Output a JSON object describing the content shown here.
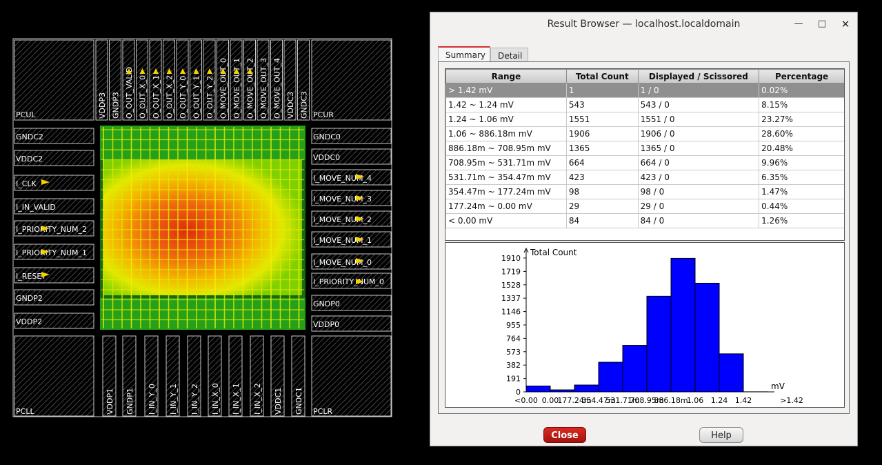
{
  "layout_view": {
    "corner_labels": [
      "PCUL",
      "PCUR",
      "PCLL",
      "PCLR"
    ],
    "left_pads": [
      "GNDC2",
      "VDDC2",
      "I_CLK",
      "I_IN_VALID",
      "I_PRIORITY_NUM_2",
      "I_PRIORITY_NUM_1",
      "I_RESET",
      "GNDP2",
      "VDDP2"
    ],
    "right_pads": [
      "GNDC0",
      "VDDC0",
      "I_MOVE_NUM_4",
      "I_MOVE_NUM_3",
      "I_MOVE_NUM_2",
      "I_MOVE_NUM_1",
      "I_MOVE_NUM_0",
      "I_PRIORITY_NUM_0",
      "GNDP0",
      "VDDP0"
    ],
    "top_pads": [
      "VDDP3",
      "GNDP3",
      "O_OUT_VALID",
      "O_OUT_X_0",
      "O_OUT_X_1",
      "O_OUT_X_2",
      "O_OUT_Y_0",
      "O_OUT_Y_1",
      "O_OUT_Y_2",
      "O_MOVE_OUT_0",
      "O_MOVE_OUT_1",
      "O_MOVE_OUT_2",
      "O_MOVE_OUT_3",
      "O_MOVE_OUT_4",
      "VDDC3",
      "GNDC3"
    ],
    "bottom_pads": [
      "VDDP1",
      "GNDP1",
      "I_IN_Y_0",
      "I_IN_Y_1",
      "I_IN_Y_2",
      "I_IN_X_0",
      "I_IN_X_1",
      "I_IN_X_2",
      "VDDC1",
      "GNDC1"
    ]
  },
  "dialog": {
    "title": "Result Browser — localhost.localdomain",
    "minimize_icon": "minimize-icon",
    "maximize_icon": "maximize-icon",
    "close_icon": "close-icon",
    "tabs": [
      {
        "label": "Summary",
        "active": true
      },
      {
        "label": "Detail",
        "active": false
      }
    ],
    "table": {
      "headers": [
        "Range",
        "Total Count",
        "Displayed / Scissored",
        "Percentage"
      ],
      "rows": [
        [
          "> 1.42 mV",
          "1",
          "1 / 0",
          "0.02%"
        ],
        [
          "1.42 ~ 1.24 mV",
          "543",
          "543 / 0",
          "8.15%"
        ],
        [
          "1.24 ~ 1.06 mV",
          "1551",
          "1551 / 0",
          "23.27%"
        ],
        [
          "1.06 ~ 886.18m mV",
          "1906",
          "1906 / 0",
          "28.60%"
        ],
        [
          "886.18m ~ 708.95m mV",
          "1365",
          "1365 / 0",
          "20.48%"
        ],
        [
          "708.95m ~ 531.71m mV",
          "664",
          "664 / 0",
          "9.96%"
        ],
        [
          "531.71m ~ 354.47m mV",
          "423",
          "423 / 0",
          "6.35%"
        ],
        [
          "354.47m ~ 177.24m mV",
          "98",
          "98 / 0",
          "1.47%"
        ],
        [
          "177.24m ~ 0.00 mV",
          "29",
          "29 / 0",
          "0.44%"
        ],
        [
          "< 0.00 mV",
          "84",
          "84 / 0",
          "1.26%"
        ]
      ],
      "selected_row": 0
    },
    "close_button": "Close",
    "help_button": "Help"
  },
  "chart_data": {
    "type": "bar",
    "ylabel": "Total Count",
    "xlabel": "mV",
    "y_ticks": [
      "0",
      "191",
      "382",
      "573",
      "764",
      "955",
      "1146",
      "1337",
      "1528",
      "1719",
      "1910"
    ],
    "x_tick_labels": [
      "<0.00",
      "0.00",
      "177.24m",
      "354.47m",
      "531.71m",
      "708.95m",
      "886.18m",
      "1.06",
      "1.24",
      "1.42",
      ">1.42"
    ],
    "categories": [
      "<0.00",
      "0.00~177.24m",
      "177.24m~354.47m",
      "354.47m~531.71m",
      "531.71m~708.95m",
      "708.95m~886.18m",
      "886.18m~1.06",
      "1.06~1.24",
      "1.24~1.42",
      ">1.42"
    ],
    "values": [
      84,
      29,
      98,
      423,
      664,
      1365,
      1906,
      1551,
      543,
      1
    ],
    "ylim": [
      0,
      1910
    ],
    "bar_color": "#0000ff",
    "grid": false
  }
}
